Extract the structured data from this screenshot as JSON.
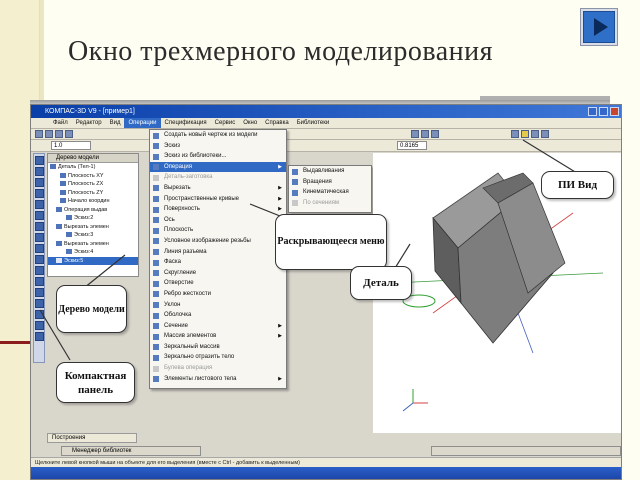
{
  "slide": {
    "title": "Окно трехмерного моделирования"
  },
  "app": {
    "window_title": "КОМПАС-3D V9 - [пример1]",
    "menu": [
      "Файл",
      "Редактор",
      "Вид",
      "Операции",
      "Спецификация",
      "Сервис",
      "Окно",
      "Справка",
      "Библиотеки"
    ],
    "scale_value": "1.0",
    "zoom_value": "0.8165",
    "tab_label": "Построения",
    "library_label": "Менеджер библиотек",
    "status_text": "Щелкните левой кнопкой мыши на объекте для его выделения (вместе с Ctrl - добавить к выделенным)"
  },
  "tree": {
    "header": "Дерево модели",
    "items": [
      "Деталь (Тел-1)",
      "Плоскость XY",
      "Плоскость ZX",
      "Плоскость ZY",
      "Начало координ",
      "Операция выдав",
      "Эскиз:2",
      "Вырезать элемен",
      "Эскиз:3",
      "Вырезать элемен",
      "Эскиз:4",
      "Эскиз:5"
    ]
  },
  "menu1": {
    "items": [
      {
        "label": "Создать новый чертеж из модели"
      },
      {
        "label": "Эскиз"
      },
      {
        "label": "Эскиз из библиотеки..."
      },
      {
        "label": "Операция"
      },
      {
        "label": "Деталь-заготовка"
      },
      {
        "label": "Вырезать"
      },
      {
        "label": "Пространственные кривые"
      },
      {
        "label": "Поверхность"
      },
      {
        "label": "Ось"
      },
      {
        "label": "Плоскость"
      },
      {
        "label": "Условное изображение резьбы"
      },
      {
        "label": "Линия разъема"
      },
      {
        "label": "Фаска"
      },
      {
        "label": "Скругление"
      },
      {
        "label": "Отверстие"
      },
      {
        "label": "Ребро жесткости"
      },
      {
        "label": "Уклон"
      },
      {
        "label": "Оболочка"
      },
      {
        "label": "Сечение"
      },
      {
        "label": "Массив элементов"
      },
      {
        "label": "Зеркальный массив"
      },
      {
        "label": "Зеркально отразить тело"
      },
      {
        "label": "Булева операция"
      },
      {
        "label": "Элементы листового тела"
      }
    ]
  },
  "menu2": {
    "items": [
      "Выдавливания",
      "Вращения",
      "Кинематическая",
      "По сечениям"
    ]
  },
  "callouts": {
    "dropdown": "Раскрывающееся меню",
    "part": "Деталь",
    "view": "ПИ Вид",
    "tree": "Дерево модели",
    "compact": "Компактная панель"
  },
  "colors": {
    "accent": "#316ac5",
    "titlebar": "#0a3fa8",
    "part_face": "#7d7d7d",
    "nav_button": "#2f6fc7"
  }
}
